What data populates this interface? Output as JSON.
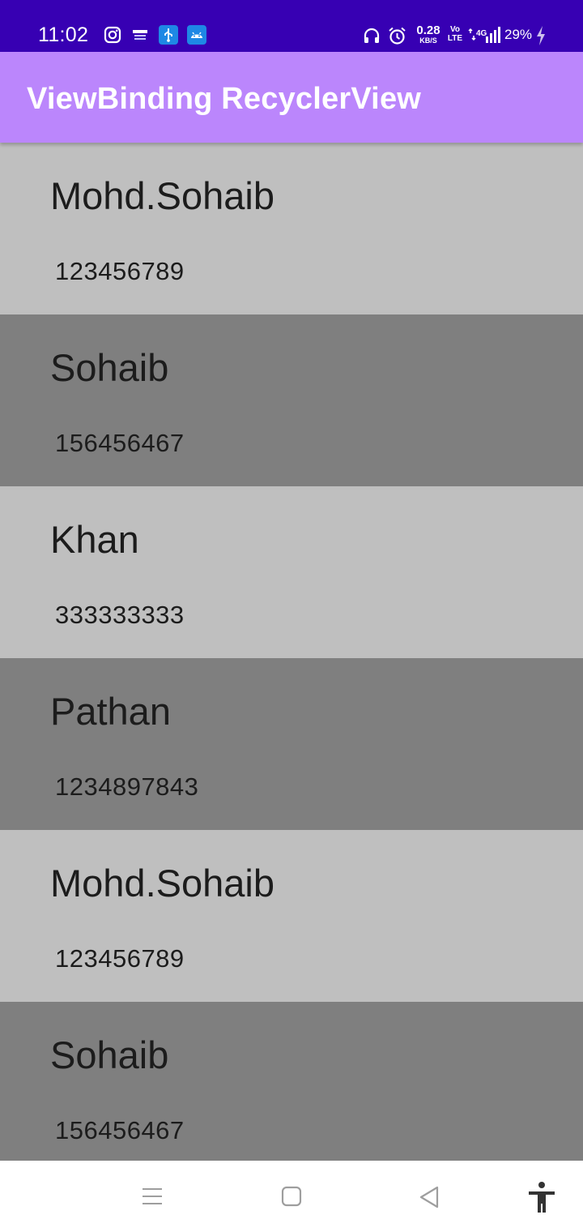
{
  "status_bar": {
    "time": "11:02",
    "network_speed_value": "0.28",
    "network_speed_unit": "KB/S",
    "volte_top": "Vo",
    "volte_bottom": "LTE",
    "network_type": "4G",
    "battery_percent": "29%",
    "background_color": "#3700b3",
    "left_icons": [
      "instagram-icon",
      "app-notification-icon",
      "usb-icon",
      "android-icon"
    ],
    "right_icons": [
      "headphones-icon",
      "alarm-icon",
      "signal-icon",
      "charging-icon"
    ]
  },
  "app_bar": {
    "title": "ViewBinding RecyclerView",
    "color": "#bb86fc"
  },
  "list": {
    "items": [
      {
        "name": "Mohd.Sohaib",
        "phone": "123456789",
        "shade": "#bfbfbf"
      },
      {
        "name": "Sohaib",
        "phone": "156456467",
        "shade": "#7f7f7f"
      },
      {
        "name": "Khan",
        "phone": "333333333",
        "shade": "#bfbfbf"
      },
      {
        "name": "Pathan",
        "phone": "1234897843",
        "shade": "#7f7f7f"
      },
      {
        "name": "Mohd.Sohaib",
        "phone": "123456789",
        "shade": "#bfbfbf"
      },
      {
        "name": "Sohaib",
        "phone": "156456467",
        "shade": "#7f7f7f"
      }
    ]
  },
  "nav_bar": {
    "buttons": [
      "menu-icon",
      "home-icon",
      "back-icon",
      "accessibility-icon"
    ]
  }
}
